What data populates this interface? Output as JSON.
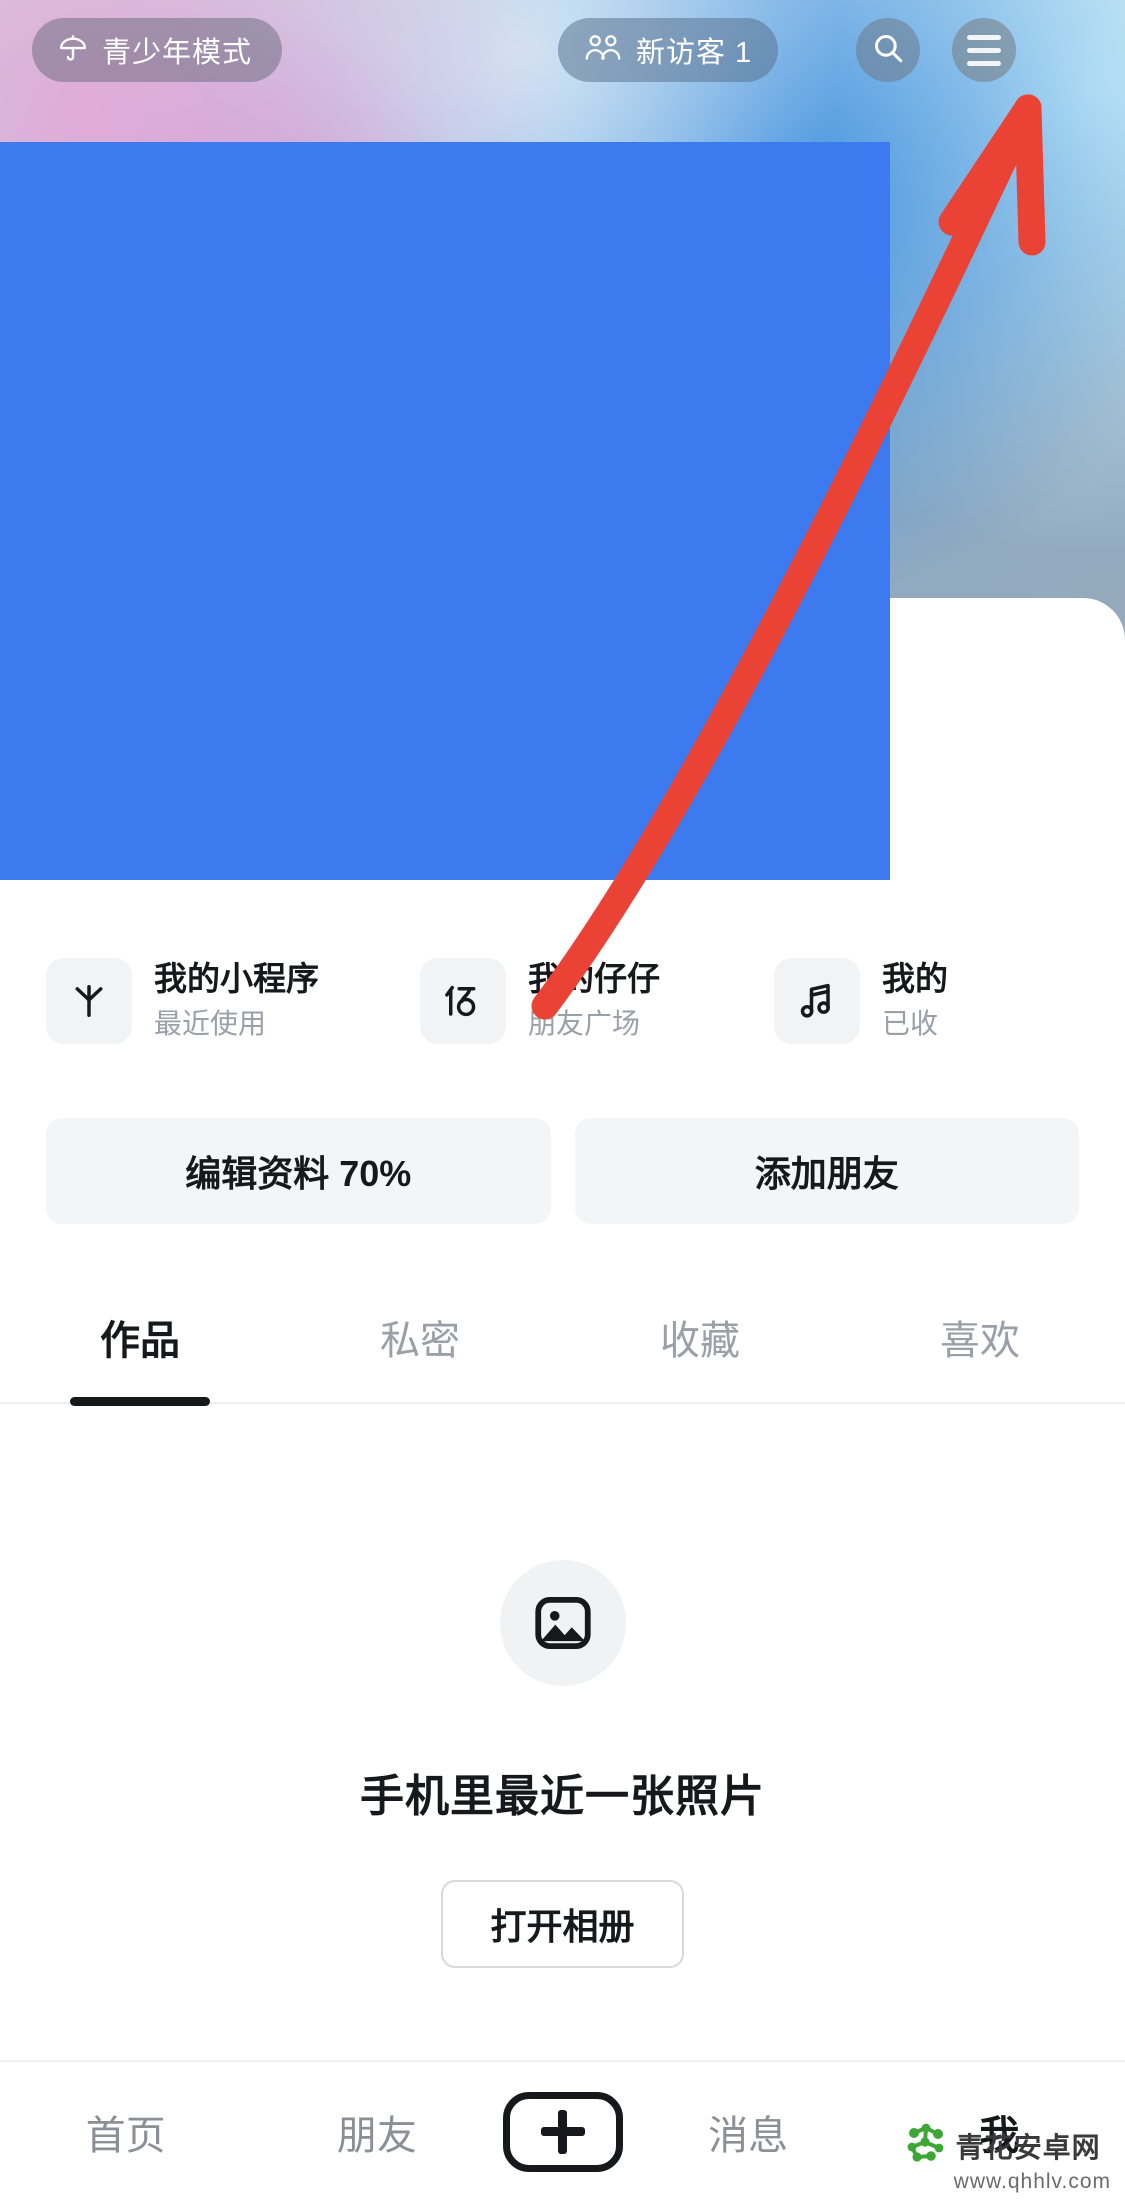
{
  "topbar": {
    "teen_mode": {
      "label": "青少年模式",
      "icon": "umbrella-icon"
    },
    "visitor": {
      "label": "新访客 1",
      "icon": "two-people-icon"
    },
    "search": {
      "icon": "search-icon"
    },
    "menu": {
      "icon": "hamburger-menu-icon"
    }
  },
  "shortcuts": [
    {
      "icon": "asterisk-icon",
      "title": "我的小程序",
      "sub": "最近使用"
    },
    {
      "icon": "zaizai-glyph-icon",
      "title": "我的仔仔",
      "sub": "朋友广场"
    },
    {
      "icon": "music-note-icon",
      "title": "我的",
      "sub": "已收"
    }
  ],
  "actions": {
    "edit_profile": "编辑资料 70%",
    "add_friend": "添加朋友"
  },
  "tabs": [
    {
      "label": "作品",
      "active": true
    },
    {
      "label": "私密",
      "active": false
    },
    {
      "label": "收藏",
      "active": false
    },
    {
      "label": "喜欢",
      "active": false
    }
  ],
  "empty_state": {
    "icon": "image-placeholder-icon",
    "text": "手机里最近一张照片",
    "button": "打开相册"
  },
  "bottom_nav": [
    {
      "label": "首页",
      "active": false
    },
    {
      "label": "朋友",
      "active": false
    },
    {
      "label": "消息",
      "active": false
    },
    {
      "label": "我",
      "active": true
    }
  ],
  "bottom_nav_plus": {
    "icon": "plus-icon"
  },
  "annotation": {
    "type": "arrow",
    "color": "#ea4335",
    "points_to": "hamburger-menu-icon"
  },
  "watermark": {
    "name": "青花安卓网",
    "url": "www.qhhlv.com",
    "logo": "green-molecule-logo"
  },
  "colors": {
    "redaction": "#3d7af0",
    "accent_dark": "#16181c",
    "muted": "#9aa0a8",
    "chip_bg": "#f2f3f5",
    "annotation_red": "#ea4335",
    "watermark_green": "#3da635"
  }
}
